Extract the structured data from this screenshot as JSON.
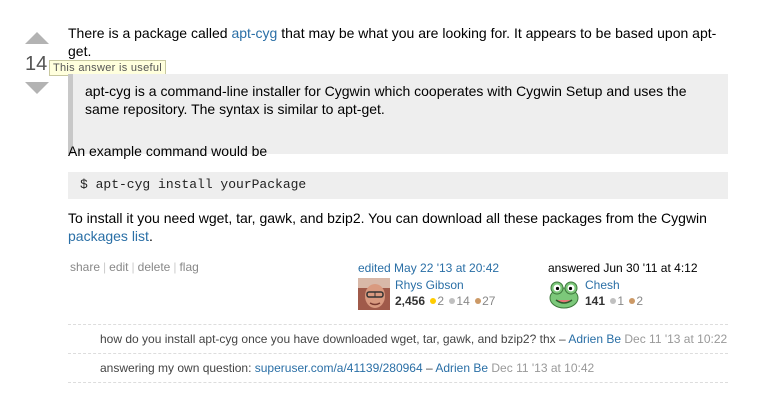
{
  "vote": {
    "count": "14",
    "tooltip": "This answer is useful",
    "up_icon": "arrow-up-icon",
    "down_icon": "arrow-down-icon"
  },
  "post": {
    "para1_pre": "There is a package called ",
    "para1_link": "apt-cyg",
    "para1_post": " that may be what you are looking for. It appears to be based upon apt-get.",
    "quote": "apt-cyg is a command-line installer for Cygwin which cooperates with Cygwin Setup and uses the same repository. The syntax is similar to apt-get.",
    "para2": "An example command would be",
    "code": "$ apt-cyg install yourPackage",
    "para3_pre": "To install it you need wget, tar, gawk, and bzip2. You can download all these packages from the Cygwin ",
    "para3_link": "packages list",
    "para3_post": "."
  },
  "menu": {
    "share": "share",
    "edit": "edit",
    "delete": "delete",
    "flag": "flag",
    "separator": "|"
  },
  "editor": {
    "action": "edited May 22 '13 at 20:42",
    "name": "Rhys Gibson",
    "rep": "2,456",
    "gold": "2",
    "silver": "14",
    "bronze": "27"
  },
  "author": {
    "action": "answered Jun 30 '11 at 4:12",
    "name": "Chesh",
    "rep": "141",
    "silver": "1",
    "bronze": "2"
  },
  "comments": [
    {
      "text": "how do you install apt-cyg once you have downloaded wget, tar, gawk, and bzip2? thx – ",
      "link": "",
      "user": "Adrien Be",
      "date": "Dec 11 '13 at 10:22"
    },
    {
      "text": "answering my own question: ",
      "link": "superuser.com/a/41139/280964",
      "sep": " – ",
      "user": "Adrien Be",
      "date": "Dec 11 '13 at 10:42"
    }
  ],
  "colors": {
    "link": "#2a6fa6",
    "quote_bg": "#eeeeee",
    "gold": "#ffcc00",
    "silver": "#c0c0c0",
    "bronze": "#cc9966"
  }
}
